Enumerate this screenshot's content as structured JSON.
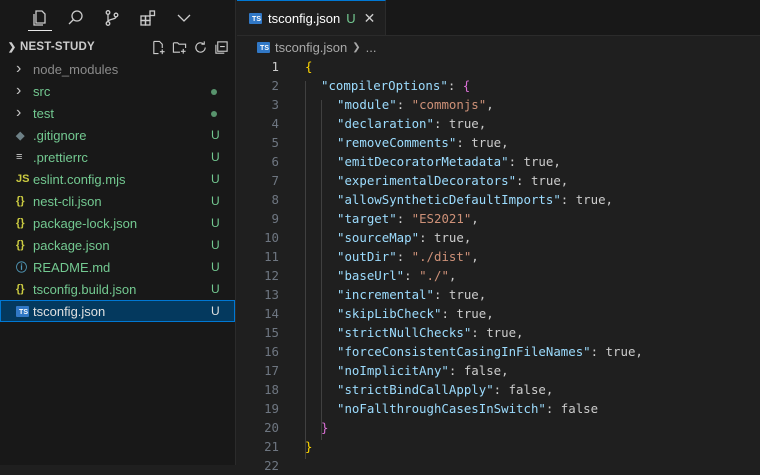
{
  "activity_bar": {
    "icons": [
      "explorer-icon",
      "search-icon",
      "source-control-icon",
      "extensions-icon",
      "more-chevron-icon"
    ]
  },
  "explorer": {
    "title": "NEST-STUDY",
    "items": [
      {
        "label": "node_modules",
        "type": "folder",
        "status": "",
        "color": "#8b8b8b"
      },
      {
        "label": "src",
        "type": "folder",
        "status": "dot",
        "color": "#73c991"
      },
      {
        "label": "test",
        "type": "folder",
        "status": "dot",
        "color": "#73c991"
      },
      {
        "label": ".gitignore",
        "type": "file",
        "icon": "◆",
        "icon_color": "#6d8086",
        "status": "U",
        "color": "#73c991"
      },
      {
        "label": ".prettierrc",
        "type": "file",
        "icon": "≡",
        "icon_color": "#cccccc",
        "status": "U",
        "color": "#73c991"
      },
      {
        "label": "eslint.config.mjs",
        "type": "file",
        "icon": "JS",
        "icon_color": "#cbcb41",
        "status": "U",
        "color": "#73c991"
      },
      {
        "label": "nest-cli.json",
        "type": "file",
        "icon": "{}",
        "icon_color": "#cbcb41",
        "status": "U",
        "color": "#73c991"
      },
      {
        "label": "package-lock.json",
        "type": "file",
        "icon": "{}",
        "icon_color": "#cbcb41",
        "status": "U",
        "color": "#73c991"
      },
      {
        "label": "package.json",
        "type": "file",
        "icon": "{}",
        "icon_color": "#cbcb41",
        "status": "U",
        "color": "#73c991"
      },
      {
        "label": "README.md",
        "type": "file",
        "icon": "ⓘ",
        "icon_color": "#519aba",
        "status": "U",
        "color": "#73c991"
      },
      {
        "label": "tsconfig.build.json",
        "type": "file",
        "icon": "{}",
        "icon_color": "#cbcb41",
        "status": "U",
        "color": "#73c991"
      },
      {
        "label": "tsconfig.json",
        "type": "file",
        "icon": "TS",
        "icon_color": "#3178c6",
        "status": "U",
        "color": "#e0e0e0",
        "selected": true
      }
    ]
  },
  "editor": {
    "tab": {
      "label": "tsconfig.json",
      "status": "U",
      "icon": "TS"
    },
    "breadcrumb": {
      "file": "tsconfig.json",
      "more": "..."
    },
    "current_line": 1,
    "lines": [
      {
        "n": "1",
        "indent": 0,
        "parts": [
          [
            "{",
            "b1"
          ]
        ]
      },
      {
        "n": "2",
        "indent": 1,
        "parts": [
          [
            "\"compilerOptions\"",
            "k"
          ],
          [
            ": ",
            "p"
          ],
          [
            "{",
            "b2"
          ]
        ]
      },
      {
        "n": "3",
        "indent": 2,
        "parts": [
          [
            "\"module\"",
            "k"
          ],
          [
            ": ",
            "p"
          ],
          [
            "\"commonjs\"",
            "s"
          ],
          [
            ",",
            "p"
          ]
        ]
      },
      {
        "n": "4",
        "indent": 2,
        "parts": [
          [
            "\"declaration\"",
            "k"
          ],
          [
            ": true,",
            "p"
          ]
        ]
      },
      {
        "n": "5",
        "indent": 2,
        "parts": [
          [
            "\"removeComments\"",
            "k"
          ],
          [
            ": true,",
            "p"
          ]
        ]
      },
      {
        "n": "6",
        "indent": 2,
        "parts": [
          [
            "\"emitDecoratorMetadata\"",
            "k"
          ],
          [
            ": true,",
            "p"
          ]
        ]
      },
      {
        "n": "7",
        "indent": 2,
        "parts": [
          [
            "\"experimentalDecorators\"",
            "k"
          ],
          [
            ": true,",
            "p"
          ]
        ]
      },
      {
        "n": "8",
        "indent": 2,
        "parts": [
          [
            "\"allowSyntheticDefaultImports\"",
            "k"
          ],
          [
            ": true,",
            "p"
          ]
        ]
      },
      {
        "n": "9",
        "indent": 2,
        "parts": [
          [
            "\"target\"",
            "k"
          ],
          [
            ": ",
            "p"
          ],
          [
            "\"ES2021\"",
            "s"
          ],
          [
            ",",
            "p"
          ]
        ]
      },
      {
        "n": "10",
        "indent": 2,
        "parts": [
          [
            "\"sourceMap\"",
            "k"
          ],
          [
            ": true,",
            "p"
          ]
        ]
      },
      {
        "n": "11",
        "indent": 2,
        "parts": [
          [
            "\"outDir\"",
            "k"
          ],
          [
            ": ",
            "p"
          ],
          [
            "\"./dist\"",
            "s"
          ],
          [
            ",",
            "p"
          ]
        ]
      },
      {
        "n": "12",
        "indent": 2,
        "parts": [
          [
            "\"baseUrl\"",
            "k"
          ],
          [
            ": ",
            "p"
          ],
          [
            "\"./\"",
            "s"
          ],
          [
            ",",
            "p"
          ]
        ]
      },
      {
        "n": "13",
        "indent": 2,
        "parts": [
          [
            "\"incremental\"",
            "k"
          ],
          [
            ": true,",
            "p"
          ]
        ]
      },
      {
        "n": "14",
        "indent": 2,
        "parts": [
          [
            "\"skipLibCheck\"",
            "k"
          ],
          [
            ": true,",
            "p"
          ]
        ]
      },
      {
        "n": "15",
        "indent": 2,
        "parts": [
          [
            "\"strictNullChecks\"",
            "k"
          ],
          [
            ": true,",
            "p"
          ]
        ]
      },
      {
        "n": "16",
        "indent": 2,
        "parts": [
          [
            "\"forceConsistentCasingInFileNames\"",
            "k"
          ],
          [
            ": true,",
            "p"
          ]
        ]
      },
      {
        "n": "17",
        "indent": 2,
        "parts": [
          [
            "\"noImplicitAny\"",
            "k"
          ],
          [
            ": false,",
            "p"
          ]
        ]
      },
      {
        "n": "18",
        "indent": 2,
        "parts": [
          [
            "\"strictBindCallApply\"",
            "k"
          ],
          [
            ": false,",
            "p"
          ]
        ]
      },
      {
        "n": "19",
        "indent": 2,
        "parts": [
          [
            "\"noFallthroughCasesInSwitch\"",
            "k"
          ],
          [
            ": false",
            "p"
          ]
        ]
      },
      {
        "n": "20",
        "indent": 1,
        "parts": [
          [
            "}",
            "b2"
          ]
        ]
      },
      {
        "n": "21",
        "indent": 0,
        "parts": [
          [
            "}",
            "b1"
          ]
        ]
      },
      {
        "n": "22",
        "indent": 0,
        "parts": []
      }
    ]
  },
  "colors": {
    "accent": "#0078d4",
    "untracked": "#73c991",
    "json_key": "#9cdcfe",
    "json_string": "#ce9178"
  }
}
